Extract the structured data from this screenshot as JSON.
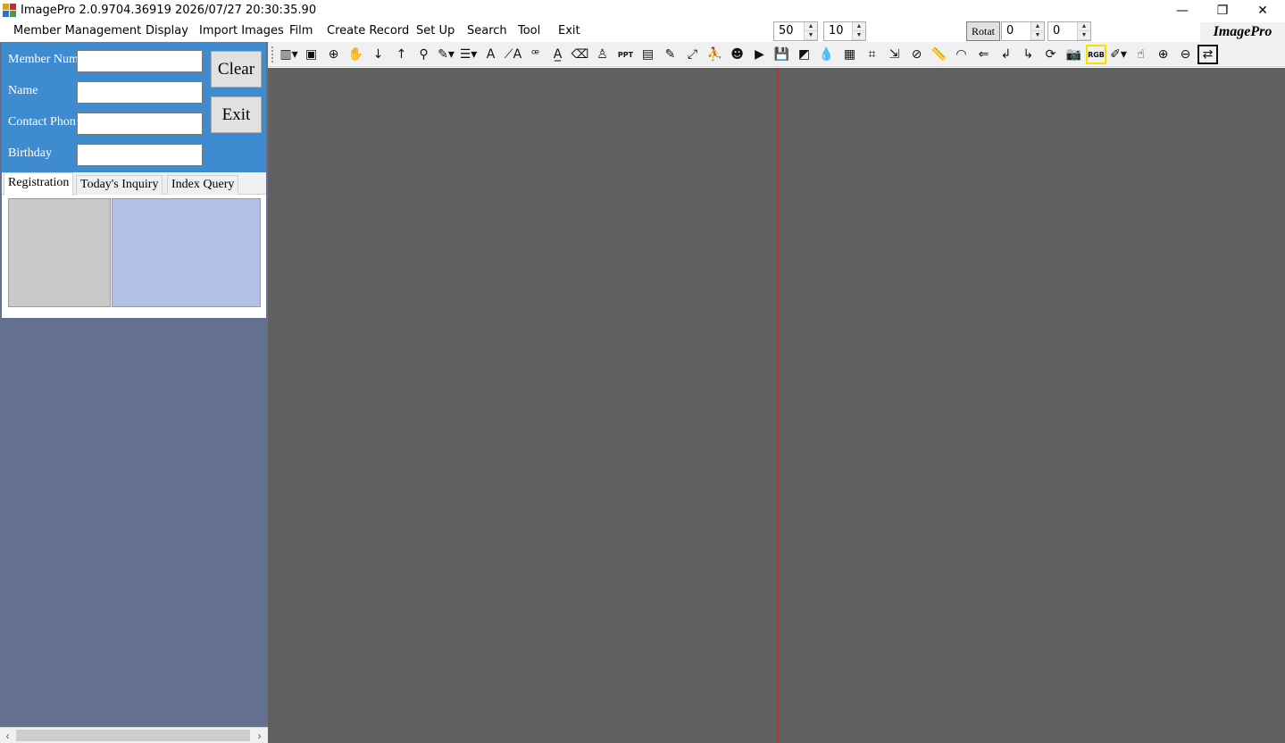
{
  "window": {
    "title": "ImagePro 2.0.9704.36919 2026/07/27 20:30:35.90",
    "minimize_glyph": "—",
    "restore_glyph": "❐",
    "close_glyph": "✕"
  },
  "menu": {
    "items": [
      "Member Management",
      "Display",
      "Import Images",
      "Film",
      "Create Record",
      "Set Up",
      "Search",
      "Tool",
      "Exit"
    ],
    "spin1_value": "50",
    "spin2_value": "10",
    "rotat_label": "Rotat",
    "spin3_value": "0",
    "spin4_value": "0",
    "brand": "ImagePro"
  },
  "form": {
    "member_num_label": "Member Num",
    "name_label": "Name",
    "contact_phone_label": "Contact Phon",
    "birthday_label": "Birthday",
    "member_num_value": "",
    "name_value": "",
    "contact_phone_value": "",
    "birthday_value": "",
    "clear_label": "Clear",
    "exit_label": "Exit"
  },
  "tabs": [
    "Registration",
    "Today's Inquiry",
    "Index Query"
  ],
  "active_tab": "Registration",
  "scrollbar": {
    "left_arrow": "‹",
    "right_arrow": "›"
  },
  "toolbar": {
    "icons": [
      {
        "name": "layout-dropdown-icon",
        "glyph": "▥▾"
      },
      {
        "name": "portrait-icon",
        "glyph": "▣"
      },
      {
        "name": "zoom-all-icon",
        "glyph": "⊕"
      },
      {
        "name": "hand-icon",
        "glyph": "✋"
      },
      {
        "name": "arrow-down-icon",
        "glyph": "↓"
      },
      {
        "name": "arrow-up-icon",
        "glyph": "↑"
      },
      {
        "name": "magnifier-icon",
        "glyph": "⚲"
      },
      {
        "name": "pen-dropdown-icon",
        "glyph": "✎▾"
      },
      {
        "name": "line-width-dropdown-icon",
        "glyph": "☰▾"
      },
      {
        "name": "text-icon",
        "glyph": "A"
      },
      {
        "name": "text-angle-icon",
        "glyph": "⟋A"
      },
      {
        "name": "find-text-icon",
        "glyph": "ꟹ"
      },
      {
        "name": "text-underline-icon",
        "glyph": "A̲"
      },
      {
        "name": "eraser-icon",
        "glyph": "⌫"
      },
      {
        "name": "stamp-icon",
        "glyph": "♙"
      },
      {
        "name": "ppt-icon",
        "glyph": "PPT"
      },
      {
        "name": "dicom-icon",
        "glyph": "▤"
      },
      {
        "name": "edit-lock-icon",
        "glyph": "✎"
      },
      {
        "name": "fullscreen-icon",
        "glyph": "⤢"
      },
      {
        "name": "person-frame-icon",
        "glyph": "⛹"
      },
      {
        "name": "person-icon",
        "glyph": "☻"
      },
      {
        "name": "play-icon",
        "glyph": "▶"
      },
      {
        "name": "save-icon",
        "glyph": "💾"
      },
      {
        "name": "contrast-icon",
        "glyph": "◩"
      },
      {
        "name": "drop-icon",
        "glyph": "💧"
      },
      {
        "name": "grid-icon",
        "glyph": "▦"
      },
      {
        "name": "crop-icon",
        "glyph": "⌗"
      },
      {
        "name": "resize-icon",
        "glyph": "⇲"
      },
      {
        "name": "cancel-icon",
        "glyph": "⊘"
      },
      {
        "name": "ruler-icon",
        "glyph": "📏"
      },
      {
        "name": "protractor-icon",
        "glyph": "◠"
      },
      {
        "name": "back-icon",
        "glyph": "⇐"
      },
      {
        "name": "turn-left-icon",
        "glyph": "↲"
      },
      {
        "name": "turn-right-icon",
        "glyph": "↳"
      },
      {
        "name": "refresh-icon",
        "glyph": "⟳"
      },
      {
        "name": "camera-icon",
        "glyph": "📷"
      },
      {
        "name": "rgb-icon",
        "glyph": "RGB"
      },
      {
        "name": "brush-dropdown-icon",
        "glyph": "✐▾"
      },
      {
        "name": "hand-touch-icon",
        "glyph": "☝"
      },
      {
        "name": "zoom-in-icon",
        "glyph": "⊕"
      },
      {
        "name": "zoom-out-icon",
        "glyph": "⊖"
      },
      {
        "name": "swap-icon",
        "glyph": "⇄"
      }
    ]
  },
  "colors": {
    "form_bg": "#3f8bd0",
    "left_panel_bg": "#64708f",
    "main_bg": "#606060",
    "split_line": "#c03030",
    "image_box_gray": "#c8c9c8",
    "image_box_blue": "#b1c0e4"
  }
}
